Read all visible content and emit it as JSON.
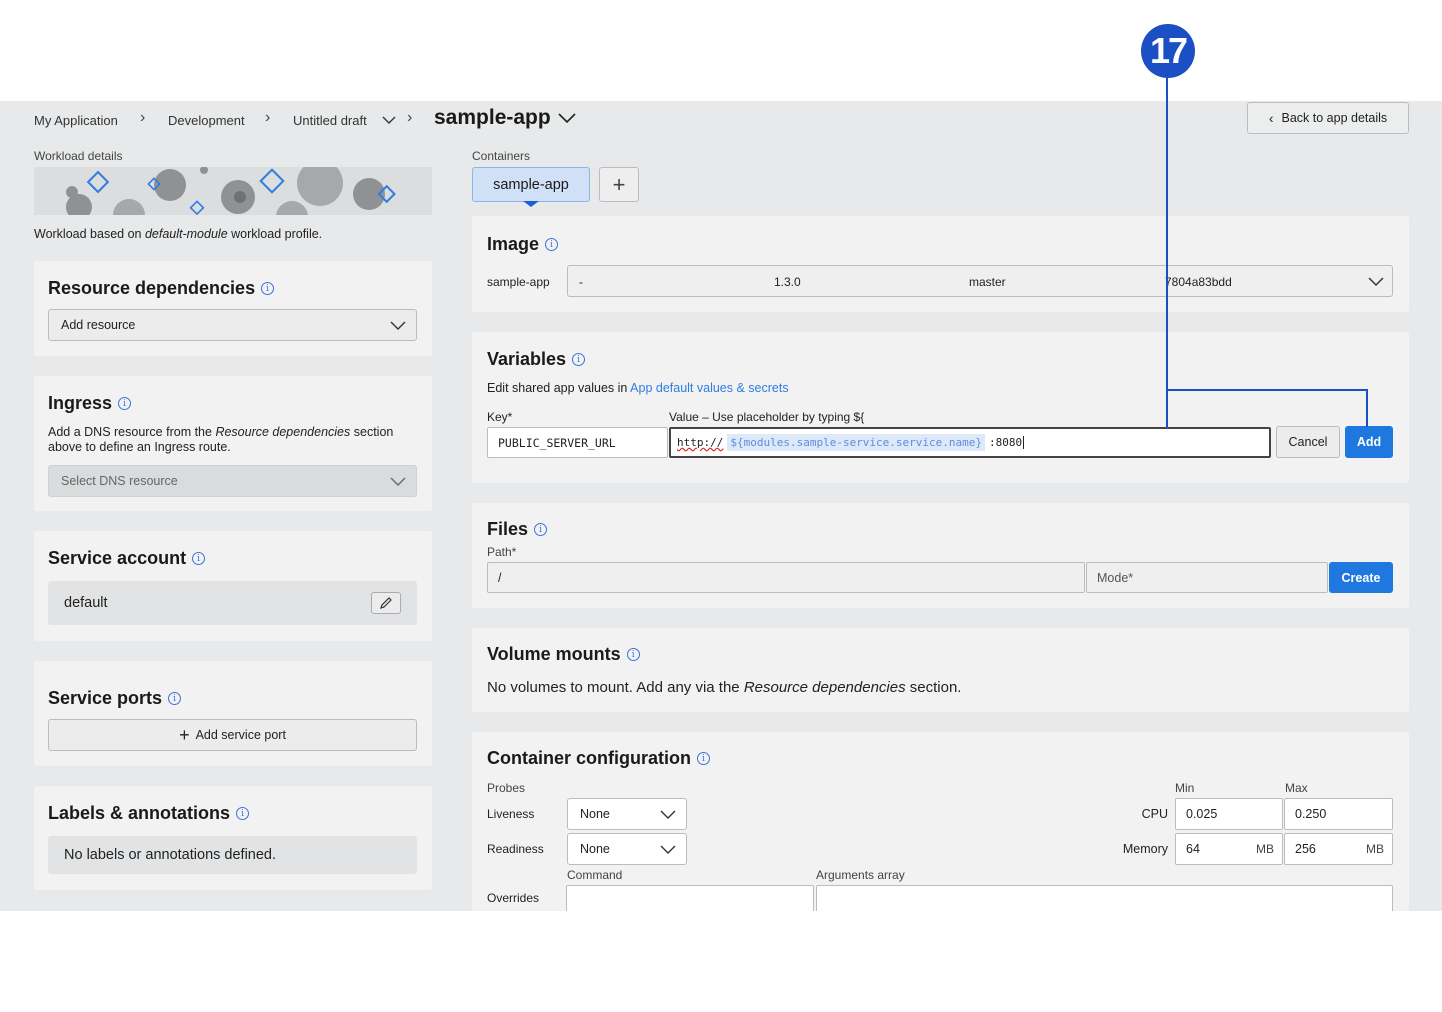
{
  "callout": {
    "number": "17"
  },
  "header": {
    "breadcrumbs": [
      {
        "label": "My Application"
      },
      {
        "label": "Development"
      },
      {
        "label": "Untitled draft"
      }
    ],
    "title": "sample-app",
    "back_button": "Back to app details"
  },
  "workload": {
    "section_label": "Workload details",
    "profile_text_prefix": "Workload based on ",
    "profile_name": "default-module",
    "profile_text_suffix": " workload profile."
  },
  "resource_dependencies": {
    "title": "Resource dependencies",
    "select_placeholder": "Add resource"
  },
  "ingress": {
    "title": "Ingress",
    "desc_prefix": "Add a DNS resource from the ",
    "desc_italic": "Resource dependencies",
    "desc_suffix": " section above to define an Ingress route.",
    "select_placeholder": "Select DNS resource"
  },
  "service_account": {
    "title": "Service account",
    "value": "default"
  },
  "service_ports": {
    "title": "Service ports",
    "add_button": "Add service port"
  },
  "labels": {
    "title": "Labels & annotations",
    "empty": "No labels or annotations defined."
  },
  "containers": {
    "section_label": "Containers",
    "tabs": [
      {
        "label": "sample-app"
      }
    ],
    "add_icon": "plus-icon"
  },
  "image": {
    "title": "Image",
    "name": "sample-app",
    "dash": "-",
    "version": "1.3.0",
    "branch": "master",
    "commit": "7804a83bdd"
  },
  "variables": {
    "title": "Variables",
    "hint_prefix": "Edit shared app values in ",
    "hint_link": "App default values & secrets",
    "key_label": "Key*",
    "value_label": "Value – Use placeholder by typing ${",
    "key_value": "PUBLIC_SERVER_URL",
    "value_protocol": "http://",
    "value_placeholder": "${modules.sample-service.service.name}",
    "value_port": ":8080",
    "cancel": "Cancel",
    "add": "Add"
  },
  "files": {
    "title": "Files",
    "path_label": "Path*",
    "path_value": "/",
    "mode_placeholder": "Mode*",
    "create": "Create"
  },
  "volume_mounts": {
    "title": "Volume mounts",
    "text_prefix": "No volumes to mount. Add any via the ",
    "text_italic": "Resource dependencies",
    "text_suffix": " section."
  },
  "container_config": {
    "title": "Container configuration",
    "probes_label": "Probes",
    "liveness_label": "Liveness",
    "liveness_value": "None",
    "readiness_label": "Readiness",
    "readiness_value": "None",
    "min_label": "Min",
    "max_label": "Max",
    "cpu_label": "CPU",
    "cpu_min": "0.025",
    "cpu_max": "0.250",
    "memory_label": "Memory",
    "mem_min": "64",
    "mem_max": "256",
    "mem_unit": "MB",
    "command_label": "Command",
    "args_label": "Arguments array",
    "overrides_label": "Overrides"
  },
  "colors": {
    "accent": "#1f78e0",
    "callout": "#1d4fc4",
    "background": "#e8e9ea",
    "card": "#f2f2f3"
  }
}
